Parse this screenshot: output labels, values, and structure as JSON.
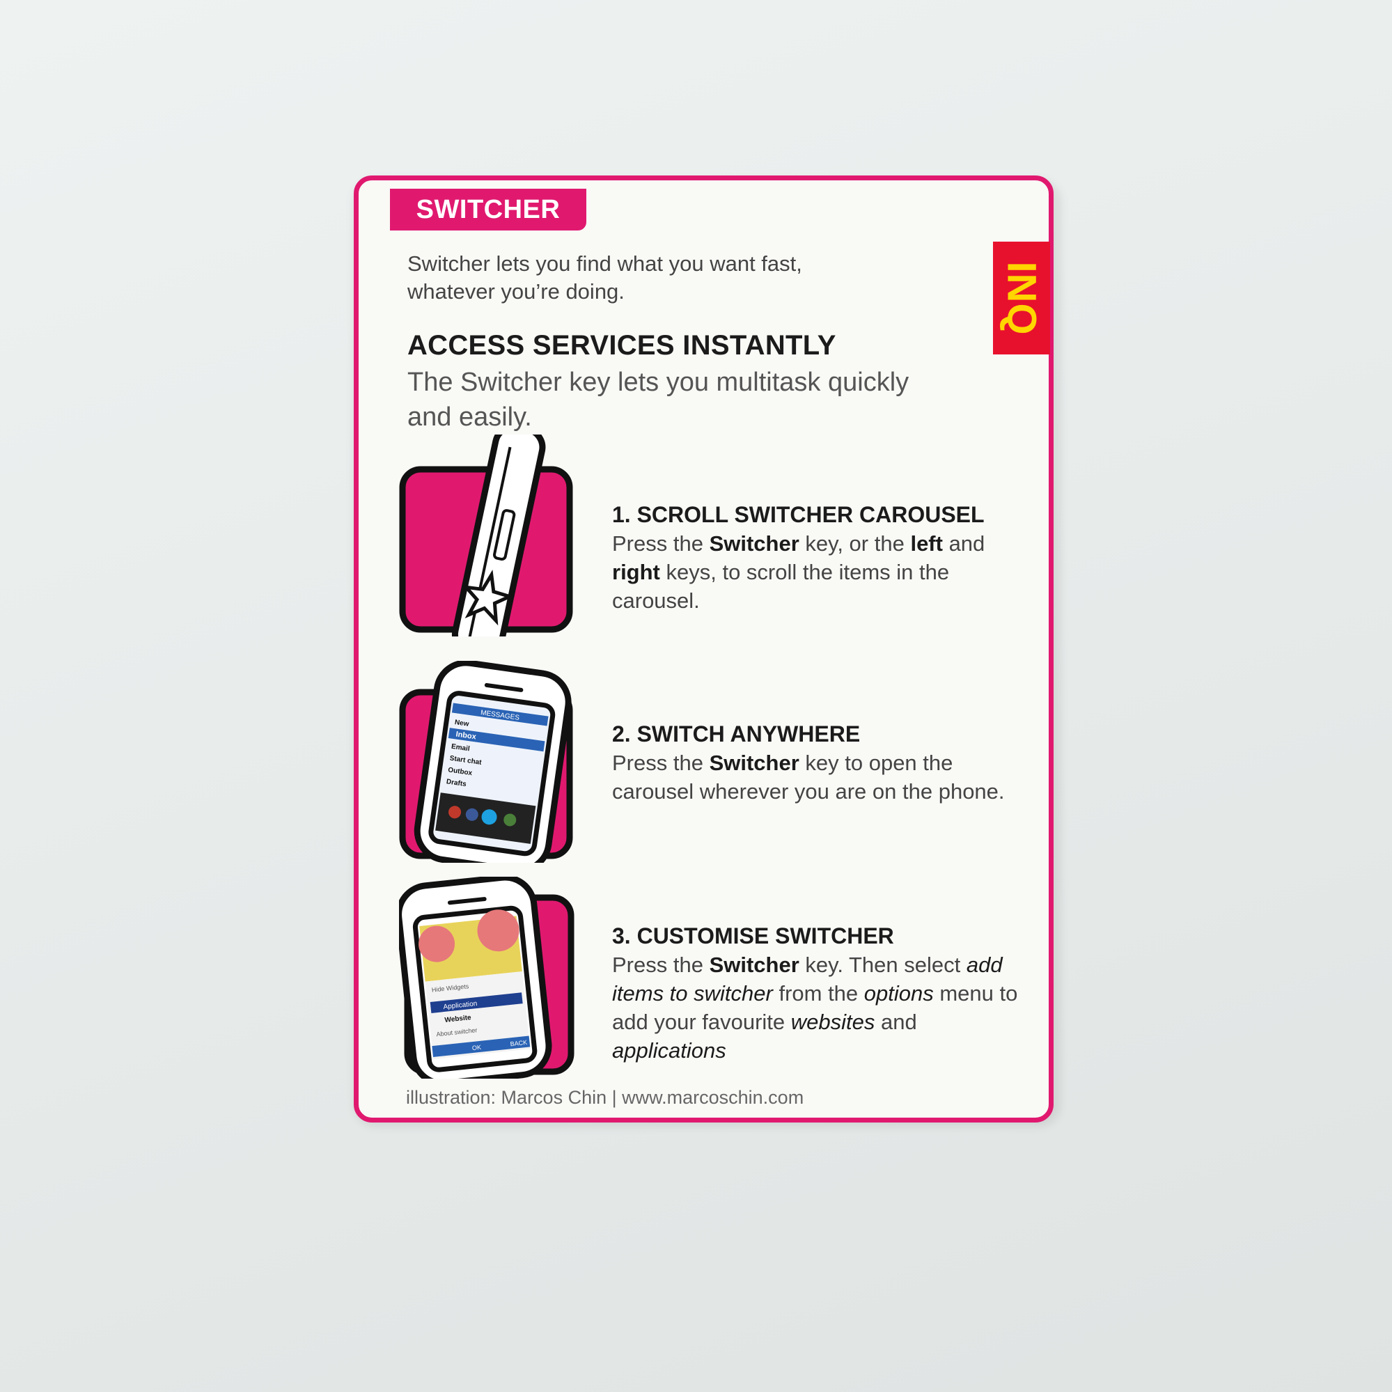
{
  "card": {
    "tab": "SWITCHER",
    "logo": "INQ",
    "intro": "Switcher lets you find what you want fast, whatever you’re doing.",
    "heading": "ACCESS SERVICES INSTANTLY",
    "heading_sub": "The Switcher key lets you multitask quickly and easily.",
    "credit": "illustration: Marcos Chin | www.marcoschin.com"
  },
  "steps": [
    {
      "title": "1. SCROLL SWITCHER CAROUSEL",
      "t1": "Press the ",
      "b1": "Switcher",
      "t2": " key, or the ",
      "b2": "left",
      "t3": " and ",
      "b3": "right",
      "t4": " keys, to scroll the items in the carousel."
    },
    {
      "title": "2. SWITCH ANYWHERE",
      "t1": "Press the ",
      "b1": "Switcher",
      "t2": " key to open the carousel wherever you are on the phone."
    },
    {
      "title": "3. CUSTOMISE SWITCHER",
      "t1": "Press the ",
      "b1": "Switcher",
      "t2": " key. Then select ",
      "i1": "add items to switcher",
      "t3": " from the ",
      "i2": "options",
      "t4": " menu to add your favourite ",
      "i3": "websites",
      "t5": " and ",
      "i4": "applications"
    }
  ],
  "phone_screen_2": {
    "header": "MESSAGES",
    "items": [
      "New",
      "Inbox",
      "Email",
      "Start chat",
      "Outbox",
      "Drafts"
    ]
  },
  "phone_screen_3": {
    "items": [
      "Hide Widgets",
      "Application",
      "Website",
      "About switcher"
    ],
    "ok": "OK",
    "back": "BACK"
  },
  "colors": {
    "accent": "#e0196f",
    "logo_bg": "#e8112d",
    "logo_text": "#ffd600"
  }
}
